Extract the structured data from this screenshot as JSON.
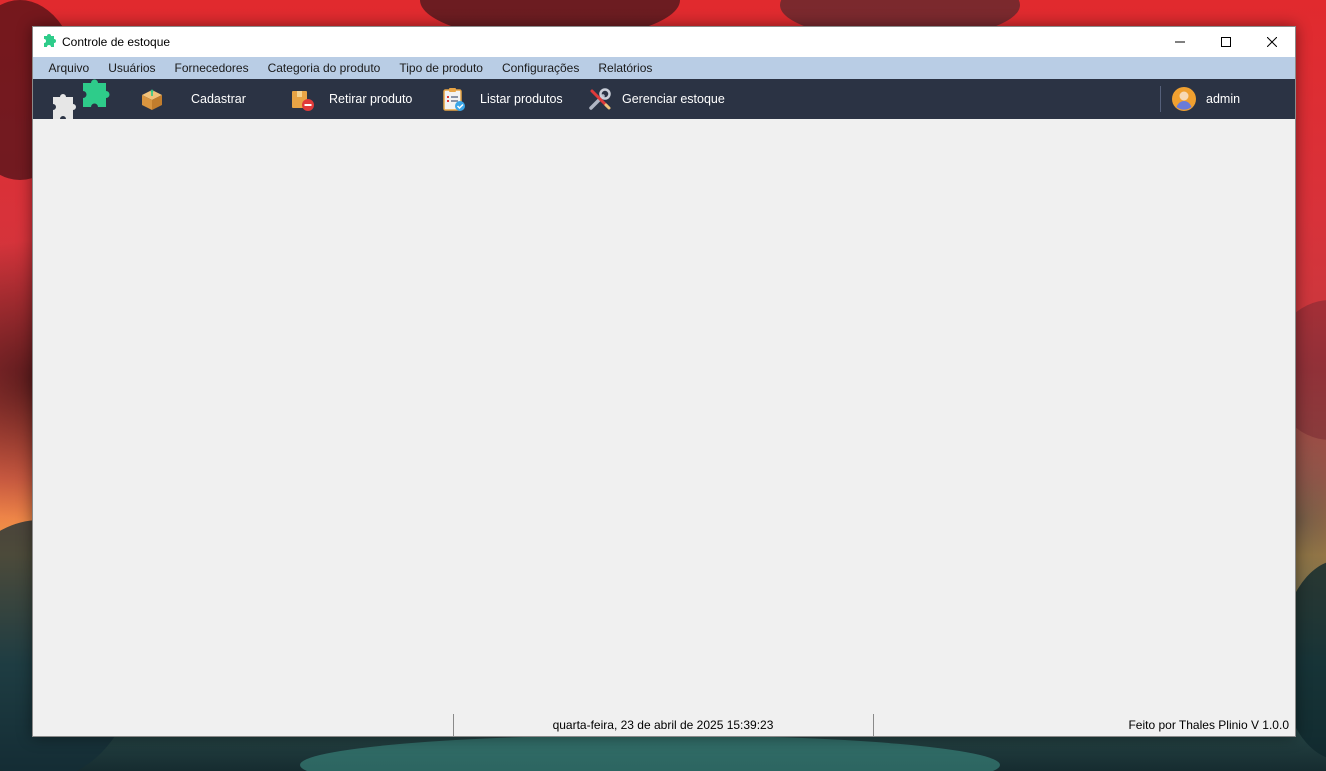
{
  "window": {
    "title": "Controle de estoque"
  },
  "menu": {
    "items": [
      {
        "label": "Arquivo"
      },
      {
        "label": "Usuários"
      },
      {
        "label": "Fornecedores"
      },
      {
        "label": "Categoria do produto"
      },
      {
        "label": "Tipo de produto"
      },
      {
        "label": "Configurações"
      },
      {
        "label": "Relatórios"
      }
    ]
  },
  "toolbar": {
    "cadastrar_label": "Cadastrar",
    "retirar_label": "Retirar produto",
    "listar_label": "Listar produtos",
    "gerenciar_label": "Gerenciar estoque",
    "user_label": "admin",
    "icons": {
      "logo": "puzzle-logo-icon",
      "cadastrar": "box-icon",
      "retirar": "box-remove-icon",
      "listar": "clipboard-list-icon",
      "gerenciar": "tools-icon",
      "user": "user-avatar-icon"
    }
  },
  "statusbar": {
    "datetime": "quarta-feira, 23 de abril de 2025 15:39:23",
    "credit": "Feito por Thales Plinio V 1.0.0"
  },
  "colors": {
    "menubar_bg": "#b9cde5",
    "toolbar_bg": "#2b3344",
    "accent_green": "#2ecc8a"
  }
}
